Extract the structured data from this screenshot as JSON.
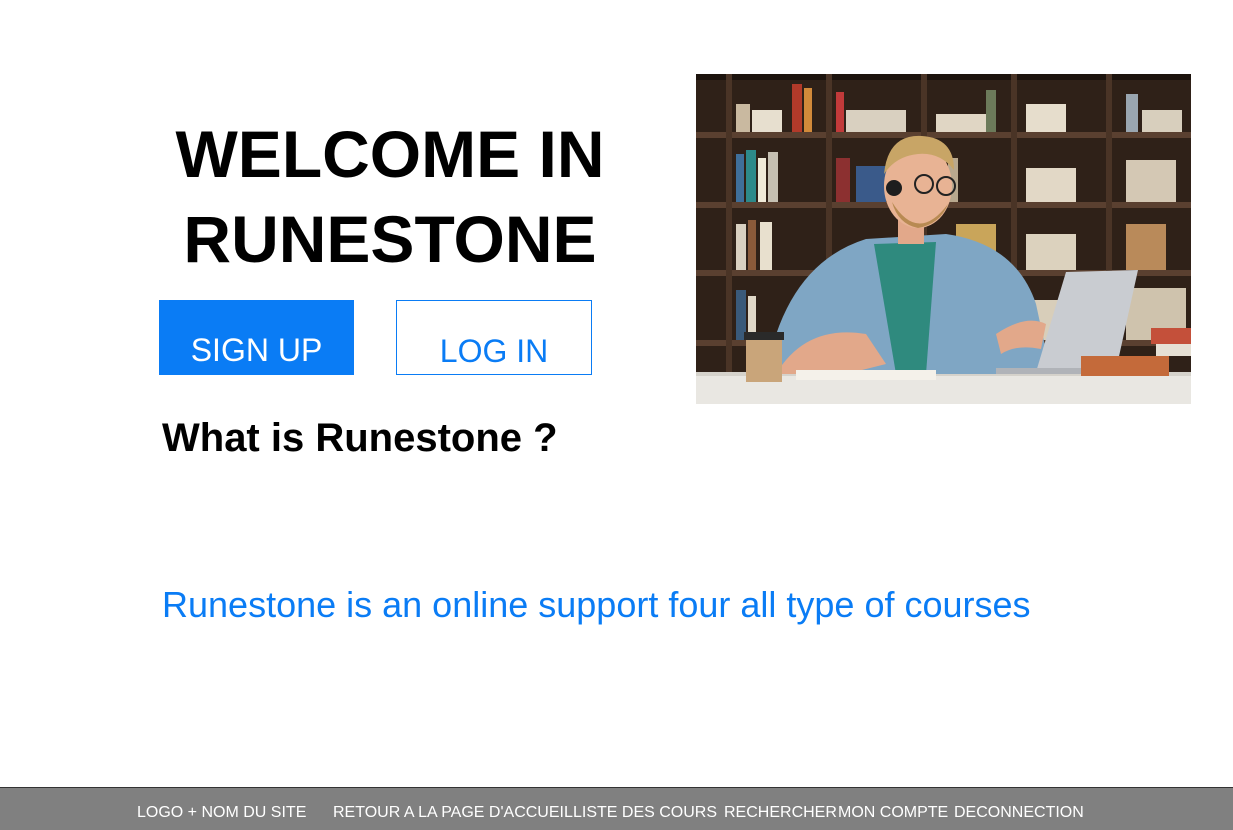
{
  "hero": {
    "title_line1": "WELCOME IN",
    "title_line2": "RUNESTONE"
  },
  "buttons": {
    "signup_label": "SIGN UP",
    "login_label": "LOG IN"
  },
  "about": {
    "heading": "What is Runestone ?",
    "tagline": "Runestone is an online support four all type of courses"
  },
  "hero_image": {
    "alt": "Student with headset studying on laptop in library"
  },
  "footer": {
    "items": [
      "LOGO + NOM DU SITE",
      "RETOUR A LA PAGE D'ACCUEIL",
      "LISTE DES COURS",
      "RECHERCHER",
      "MON COMPTE",
      "DECONNECTION"
    ]
  },
  "colors": {
    "accent": "#0a7cf5",
    "footer_bg": "#808080"
  }
}
